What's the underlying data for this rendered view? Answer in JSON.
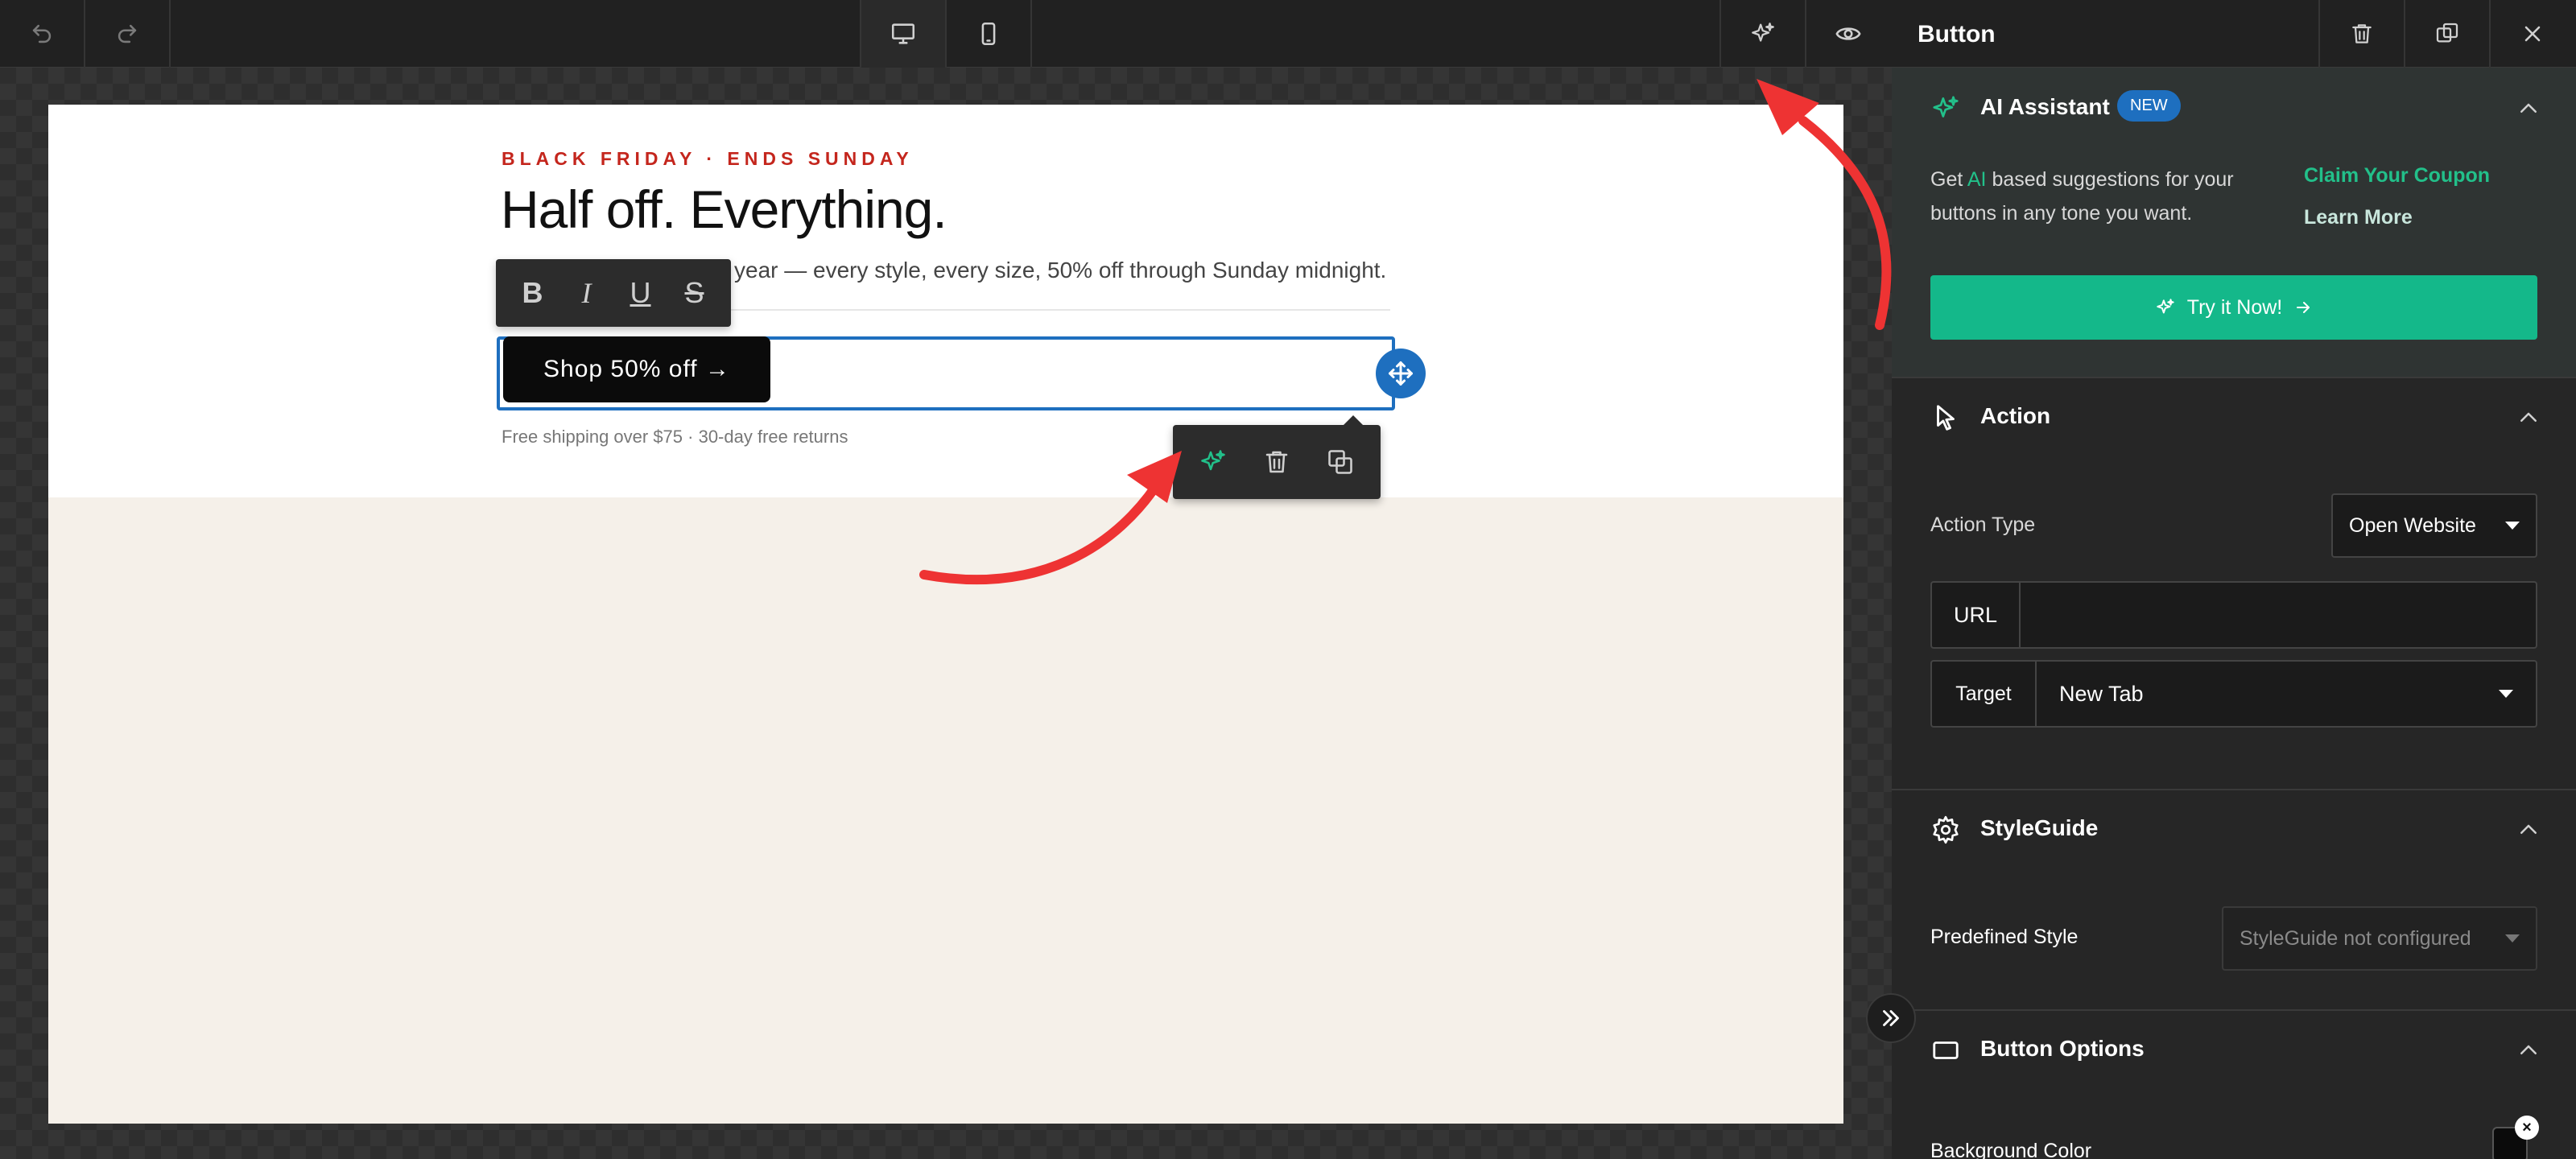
{
  "toolbar": {
    "undo_icon": "undo-icon",
    "redo_icon": "redo-icon",
    "desktop_icon": "desktop-icon",
    "mobile_icon": "mobile-icon",
    "ai_icon": "sparkle-icon",
    "preview_icon": "eye-icon"
  },
  "email": {
    "eyebrow": "BLACK FRIDAY · ENDS SUNDAY",
    "headline": "Half off. Everything.",
    "subline": "year — every style, every size, 50% off through Sunday midnight.",
    "cta_label": "Shop 50% off →",
    "fine_print": "Free shipping over $75 · 30-day free returns",
    "top_bg": "#ffffff",
    "bottom_bg": "#f5f0e9",
    "eyebrow_color": "#c4261d"
  },
  "format_toolbar": {
    "bold": "B",
    "italic": "I",
    "underline": "U",
    "strike": "S"
  },
  "panel": {
    "title": "Button",
    "ai": {
      "title": "AI Assistant",
      "badge": "NEW",
      "desc_pre": "Get ",
      "desc_hl": "AI",
      "desc_post": " based suggestions for your buttons in any tone you want.",
      "coupon": "Claim Your Coupon",
      "learn_more": "Learn More",
      "try_label": "Try it Now!"
    },
    "action": {
      "title": "Action",
      "type_label": "Action Type",
      "type_value": "Open Website",
      "url_label": "URL",
      "url_value": "",
      "target_label": "Target",
      "target_value": "New Tab"
    },
    "styleguide": {
      "title": "StyleGuide",
      "predefined_label": "Predefined Style",
      "predefined_value": "StyleGuide not configured"
    },
    "button_options": {
      "title": "Button Options",
      "bg_label": "Background Color",
      "bg_value": "#0b0b0b"
    }
  },
  "colors": {
    "accent_green": "#14b88a",
    "accent_blue": "#1e6fbf",
    "annotation_red": "#ee3333"
  }
}
